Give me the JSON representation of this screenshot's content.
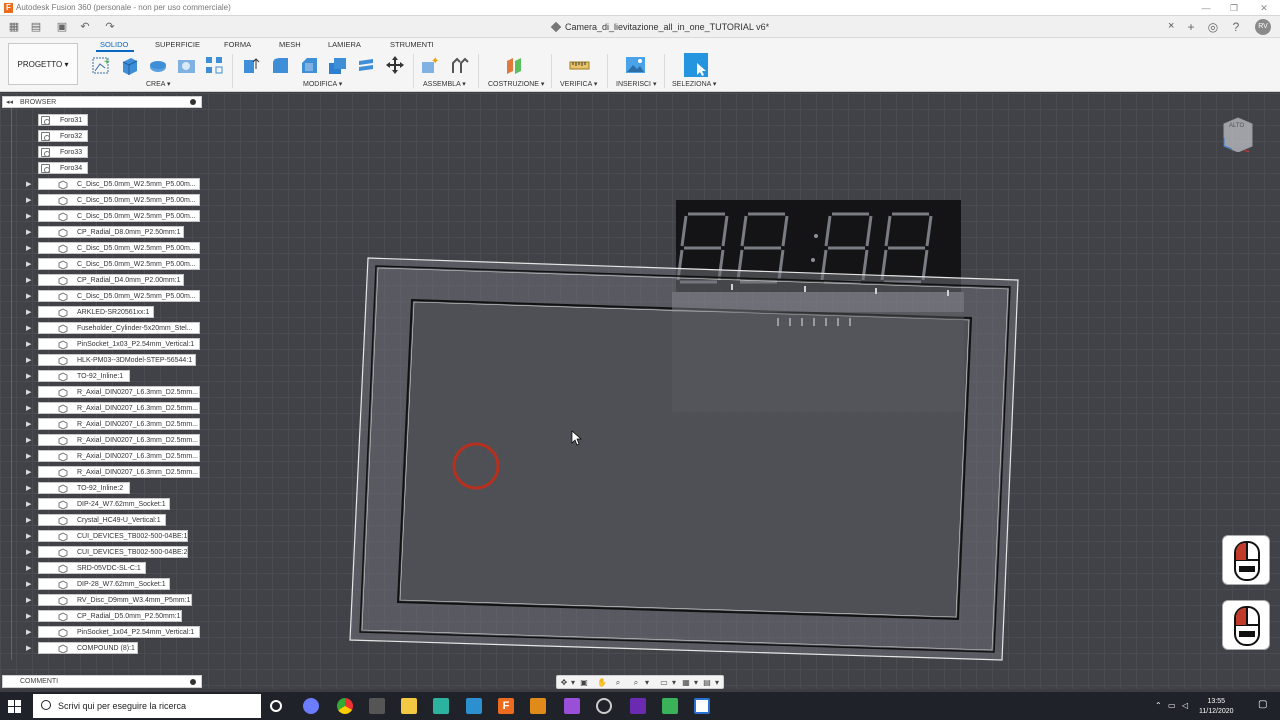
{
  "titlebar": {
    "app_title": "Autodesk Fusion 360 (personale - non per uso commerciale)",
    "app_logo": "F"
  },
  "document": {
    "title": "Camera_di_lievitazione_all_in_one_TUTORIAL v6*",
    "close": "×"
  },
  "user": {
    "initials": "RV"
  },
  "ribbon": {
    "project_button": "PROGETTO ▾",
    "tabs": [
      "SOLIDO",
      "SUPERFICIE",
      "FORMA",
      "MESH",
      "LAMIERA",
      "STRUMENTI"
    ],
    "groups": [
      "CREA ▾",
      "MODIFICA ▾",
      "ASSEMBLA ▾",
      "COSTRUZIONE ▾",
      "VERIFICA ▾",
      "INSERISCI ▾",
      "SELEZIONA ▾"
    ]
  },
  "browser": {
    "title": "BROWSER",
    "foro_items": [
      "Foro31",
      "Foro32",
      "Foro33",
      "Foro34"
    ],
    "components": [
      "C_Disc_D5.0mm_W2.5mm_P5.00m...",
      "C_Disc_D5.0mm_W2.5mm_P5.00m...",
      "C_Disc_D5.0mm_W2.5mm_P5.00m...",
      "CP_Radial_D8.0mm_P2.50mm:1",
      "C_Disc_D5.0mm_W2.5mm_P5.00m...",
      "C_Disc_D5.0mm_W2.5mm_P5.00m...",
      "CP_Radial_D4.0mm_P2.00mm:1",
      "C_Disc_D5.0mm_W2.5mm_P5.00m...",
      "ARKLED-SR20561xx:1",
      "Fuseholder_Cylinder-5x20mm_Stel...",
      "PinSocket_1x03_P2.54mm_Vertical:1",
      "HLK-PM03--3DModel-STEP-56544:1",
      "TO-92_Inline:1",
      "R_Axial_DIN0207_L6.3mm_D2.5mm...",
      "R_Axial_DIN0207_L6.3mm_D2.5mm...",
      "R_Axial_DIN0207_L6.3mm_D2.5mm...",
      "R_Axial_DIN0207_L6.3mm_D2.5mm...",
      "R_Axial_DIN0207_L6.3mm_D2.5mm...",
      "R_Axial_DIN0207_L6.3mm_D2.5mm...",
      "TO-92_Inline:2",
      "DIP-24_W7.62mm_Socket:1",
      "Crystal_HC49-U_Vertical:1",
      "CUI_DEVICES_TB002-500-04BE:1",
      "CUI_DEVICES_TB002-500-04BE:2",
      "SRD-05VDC-SL-C:1",
      "DIP-28_W7.62mm_Socket:1",
      "RV_Disc_D9mm_W3.4mm_P5mm:1",
      "CP_Radial_D5.0mm_P2.50mm:1",
      "PinSocket_1x04_P2.54mm_Vertical:1",
      "COMPOUND (8):1"
    ]
  },
  "comments": {
    "title": "COMMENTI"
  },
  "viewcube": {
    "face_label": "ALTO"
  },
  "taskbar": {
    "search_placeholder": "Scrivi qui per eseguire la ricerca",
    "time": "13:55",
    "date": "11/12/2020"
  }
}
